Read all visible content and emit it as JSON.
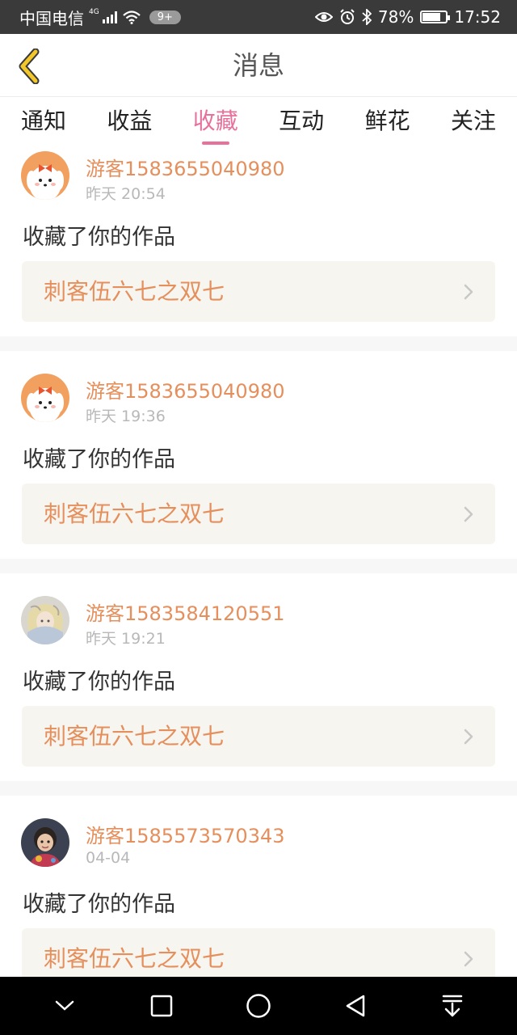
{
  "status_bar": {
    "carrier": "中国电信",
    "network": "4G",
    "notifications": "9+",
    "battery": "78%",
    "battery_level": 0.78,
    "time": "17:52"
  },
  "header": {
    "title": "消息",
    "back_icon": "chevron-left-icon"
  },
  "tabs": [
    {
      "label": "通知",
      "active": false
    },
    {
      "label": "收益",
      "active": false
    },
    {
      "label": "收藏",
      "active": true
    },
    {
      "label": "互动",
      "active": false
    },
    {
      "label": "鲜花",
      "active": false
    },
    {
      "label": "关注",
      "active": false
    }
  ],
  "messages": [
    {
      "user": "游客1583655040980",
      "time": "昨天 20:54",
      "action": "收藏了你的作品",
      "work": "刺客伍六七之双七",
      "avatar": "cartoon-dog-avatar"
    },
    {
      "user": "游客1583655040980",
      "time": "昨天 19:36",
      "action": "收藏了你的作品",
      "work": "刺客伍六七之双七",
      "avatar": "cartoon-dog-avatar"
    },
    {
      "user": "游客1583584120551",
      "time": "昨天 19:21",
      "action": "收藏了你的作品",
      "work": "刺客伍六七之双七",
      "avatar": "anime-girl-avatar"
    },
    {
      "user": "游客1585573570343",
      "time": "04-04",
      "action": "收藏了你的作品",
      "work": "刺客伍六七之双七",
      "avatar": "child-photo-avatar"
    }
  ],
  "nav_bar": [
    "chevron-down-icon",
    "square-icon",
    "circle-home-icon",
    "triangle-back-icon",
    "pull-down-icon"
  ],
  "colors": {
    "accent": "#e8719b",
    "username": "#e58f5c",
    "work_bg": "#f6f5f0",
    "back_arrow": "#f2c72b"
  }
}
